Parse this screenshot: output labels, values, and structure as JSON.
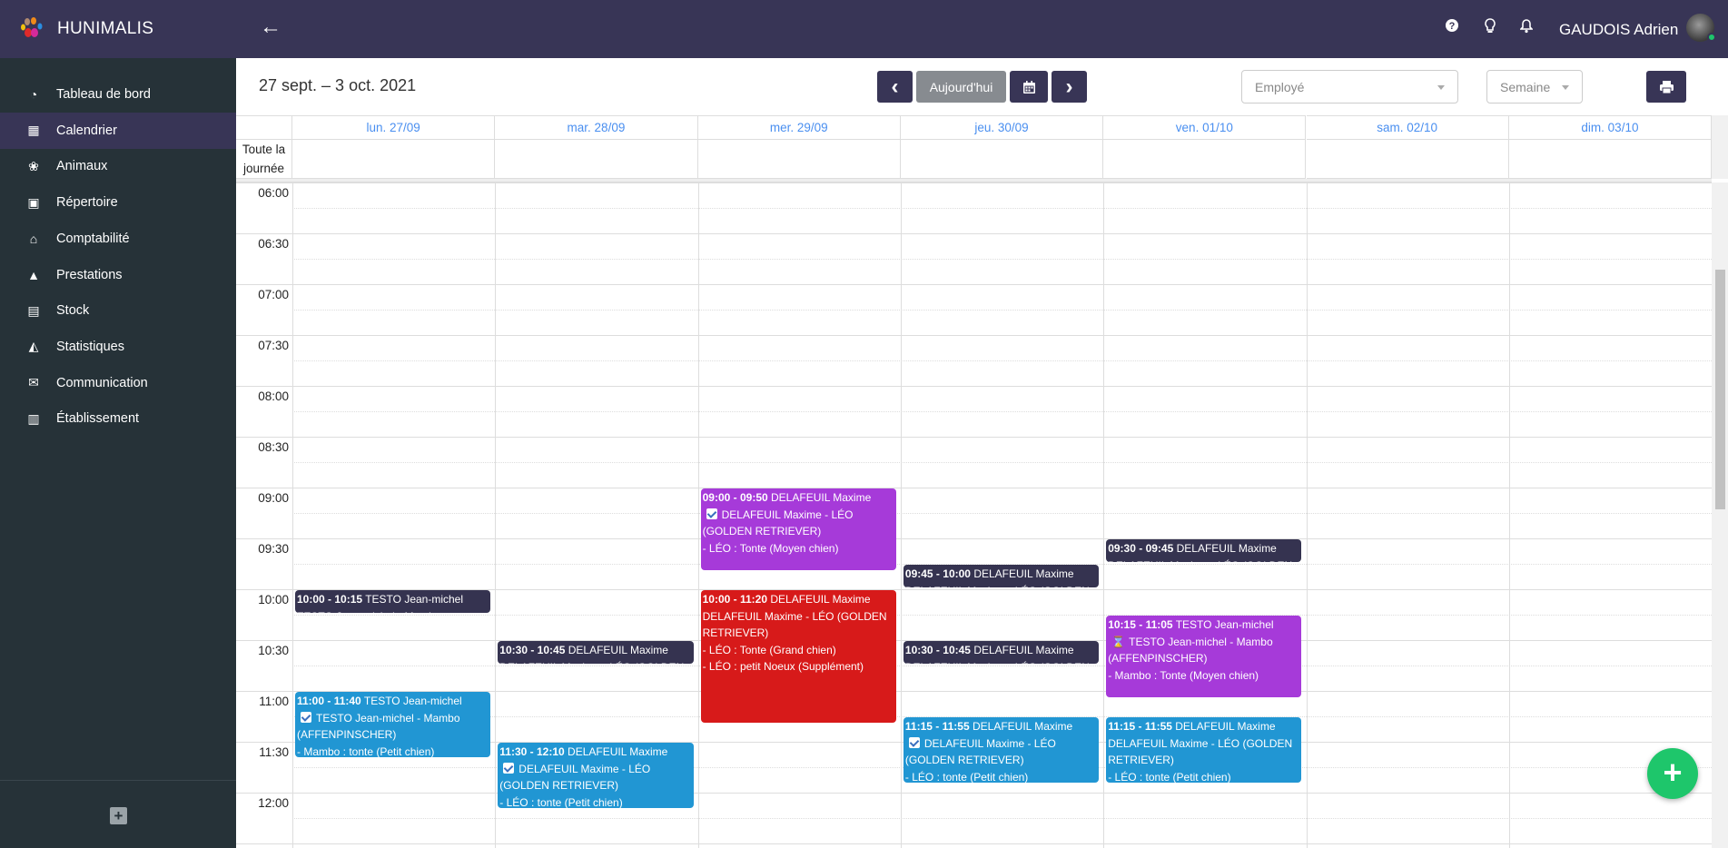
{
  "app": {
    "brand": "HUNIMALIS",
    "back_icon": "arrow-left-icon"
  },
  "header": {
    "user_name": "GAUDOIS Adrien",
    "icons": [
      "help-icon",
      "lightbulb-icon",
      "bell-icon"
    ]
  },
  "sidebar": {
    "items": [
      {
        "label": "Tableau de bord",
        "icon": "dashboard-icon",
        "glyph": "◔"
      },
      {
        "label": "Calendrier",
        "icon": "calendar-icon",
        "glyph": "▦",
        "active": true
      },
      {
        "label": "Animaux",
        "icon": "paw-icon",
        "glyph": "❀"
      },
      {
        "label": "Répertoire",
        "icon": "address-book-icon",
        "glyph": "▣"
      },
      {
        "label": "Comptabilité",
        "icon": "bank-icon",
        "glyph": "⌂"
      },
      {
        "label": "Prestations",
        "icon": "service-bell-icon",
        "glyph": "▲"
      },
      {
        "label": "Stock",
        "icon": "warehouse-icon",
        "glyph": "▤"
      },
      {
        "label": "Statistiques",
        "icon": "chart-area-icon",
        "glyph": "◭"
      },
      {
        "label": "Communication",
        "icon": "mail-bulk-icon",
        "glyph": "✉"
      },
      {
        "label": "Établissement",
        "icon": "building-icon",
        "glyph": "▥"
      }
    ]
  },
  "toolbar": {
    "range": "27 sept. – 3 oct. 2021",
    "prev": "‹",
    "today": "Aujourd'hui",
    "next": "›",
    "employee_placeholder": "Employé",
    "view": "Semaine"
  },
  "calendar": {
    "all_day_label": "Toute la journée",
    "days": [
      "lun. 27/09",
      "mar. 28/09",
      "mer. 29/09",
      "jeu. 30/09",
      "ven. 01/10",
      "sam. 02/10",
      "dim. 03/10"
    ],
    "times": [
      "06:00",
      "06:30",
      "07:00",
      "07:30",
      "08:00",
      "08:30",
      "09:00",
      "09:30",
      "10:00",
      "10:30",
      "11:00",
      "11:30",
      "12:00"
    ],
    "colors": {
      "dark": "#353350",
      "blue": "#2196d3",
      "purple": "#a63ad9",
      "red": "#d71a1a"
    },
    "events": [
      {
        "day": 0,
        "start": "10:00",
        "end": "10:15",
        "color": "dark",
        "title": "TESTO Jean-michel",
        "icon": "",
        "lines": [
          "TESTO Jean-michel - Mambo (AFFENPINSCHER)"
        ]
      },
      {
        "day": 0,
        "start": "11:00",
        "end": "11:40",
        "color": "blue",
        "title": "TESTO Jean-michel",
        "icon": "check",
        "lines": [
          "TESTO Jean-michel - Mambo (AFFENPINSCHER)",
          "- Mambo : tonte (Petit chien)"
        ]
      },
      {
        "day": 1,
        "start": "10:30",
        "end": "10:45",
        "color": "dark",
        "title": "DELAFEUIL Maxime",
        "icon": "",
        "lines": [
          "DELAFEUIL Maxime - LÉO (GOLDEN RETRIEVER)"
        ]
      },
      {
        "day": 1,
        "start": "11:30",
        "end": "12:10",
        "color": "blue",
        "title": "DELAFEUIL Maxime",
        "icon": "check",
        "lines": [
          "DELAFEUIL Maxime - LÉO (GOLDEN RETRIEVER)",
          "- LÉO : tonte (Petit chien)"
        ]
      },
      {
        "day": 2,
        "start": "09:00",
        "end": "09:50",
        "color": "purple",
        "title": "DELAFEUIL Maxime",
        "icon": "check",
        "lines": [
          "DELAFEUIL Maxime - LÉO (GOLDEN RETRIEVER)",
          "- LÉO : Tonte (Moyen chien)"
        ]
      },
      {
        "day": 2,
        "start": "10:00",
        "end": "11:20",
        "color": "red",
        "title": "DELAFEUIL Maxime",
        "icon": "",
        "lines": [
          "DELAFEUIL Maxime - LÉO (GOLDEN RETRIEVER)",
          "- LÉO : Tonte (Grand chien)",
          "- LÉO : petit Noeux (Supplément)"
        ]
      },
      {
        "day": 3,
        "start": "09:45",
        "end": "10:00",
        "color": "dark",
        "title": "DELAFEUIL Maxime",
        "icon": "",
        "lines": [
          "DELAFEUIL Maxime - LÉO (GOLDEN RETRIEVER)"
        ]
      },
      {
        "day": 3,
        "start": "10:30",
        "end": "10:45",
        "color": "dark",
        "title": "DELAFEUIL Maxime",
        "icon": "",
        "lines": [
          "DELAFEUIL Maxime - LÉO (GOLDEN RETRIEVER)"
        ]
      },
      {
        "day": 3,
        "start": "11:15",
        "end": "11:55",
        "color": "blue",
        "title": "DELAFEUIL Maxime",
        "icon": "check",
        "lines": [
          "DELAFEUIL Maxime - LÉO (GOLDEN RETRIEVER)",
          "- LÉO : tonte (Petit chien)"
        ]
      },
      {
        "day": 4,
        "start": "09:30",
        "end": "09:45",
        "color": "dark",
        "title": "DELAFEUIL Maxime",
        "icon": "",
        "lines": [
          "DELAFEUIL Maxime - LÉO (GOLDEN RETRIEVER)"
        ]
      },
      {
        "day": 4,
        "start": "10:15",
        "end": "11:05",
        "color": "purple",
        "title": "TESTO Jean-michel",
        "icon": "hourglass",
        "lines": [
          "TESTO Jean-michel - Mambo (AFFENPINSCHER)",
          "- Mambo : Tonte (Moyen chien)"
        ]
      },
      {
        "day": 4,
        "start": "11:15",
        "end": "11:55",
        "color": "blue",
        "title": "DELAFEUIL Maxime",
        "icon": "",
        "lines": [
          "DELAFEUIL Maxime - LÉO (GOLDEN RETRIEVER)",
          "- LÉO : tonte (Petit chien)"
        ]
      }
    ]
  },
  "fab": {
    "label": "+"
  }
}
